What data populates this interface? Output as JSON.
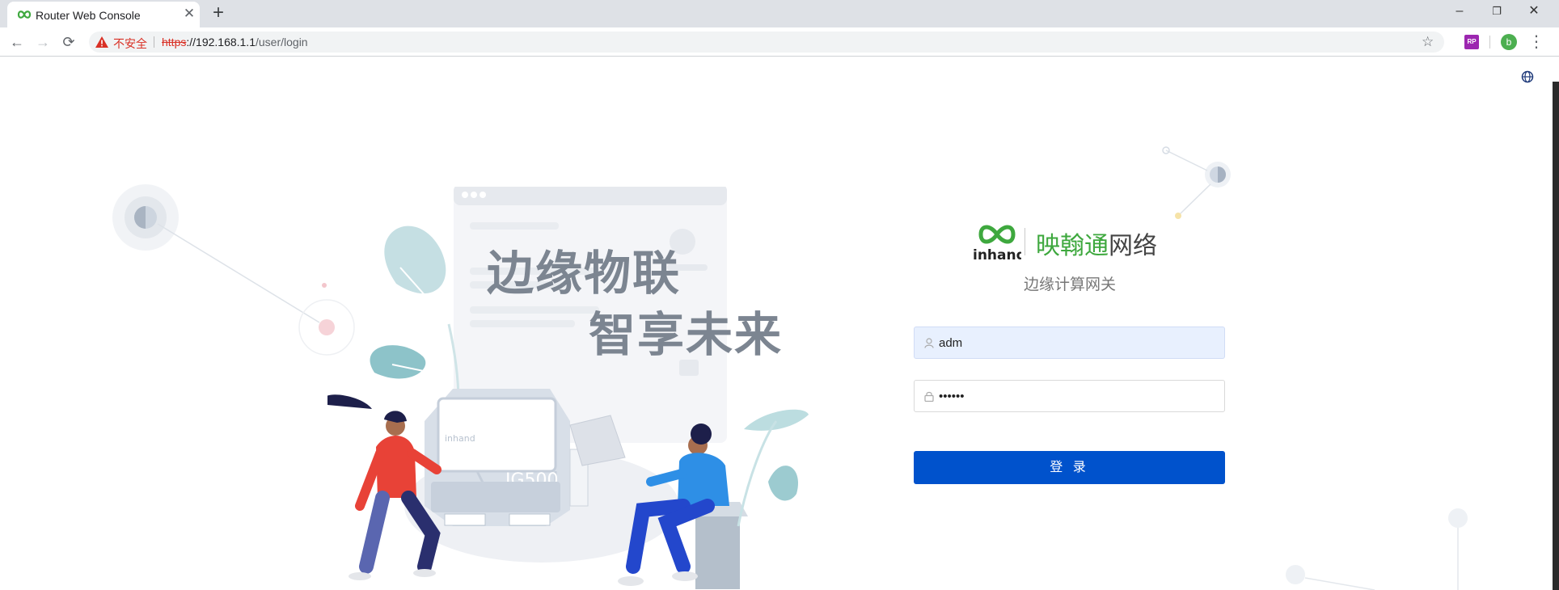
{
  "browser": {
    "tab": {
      "title": "Router Web Console",
      "close_glyph": "✕"
    },
    "new_tab_glyph": "+",
    "window_controls": {
      "minimize": "–",
      "restore": "❐",
      "close": "✕"
    },
    "nav": {
      "back": "←",
      "forward": "→",
      "reload": "⟳"
    },
    "address": {
      "security_label": "不安全",
      "url_scheme": "https",
      "url_host": "://192.168.1.1",
      "url_path": "/user/login"
    },
    "bookmark_glyph": "☆",
    "extension_label": "RP",
    "profile_initial": "b",
    "menu_glyph": "⋮",
    "accent_warning": "#d93025"
  },
  "hero": {
    "slogan_line1": "边缘物联",
    "slogan_line2": "智享未来",
    "device_brand": "inhand",
    "device_model": "IG500"
  },
  "brand": {
    "logo_text": "inhand",
    "name_green": "映翰通",
    "name_dark": "网络",
    "subtitle": "边缘计算网关"
  },
  "login": {
    "username_value": "adm",
    "password_value": "••••••",
    "submit_label": "登 录",
    "button_color": "#0052cc"
  },
  "icons": {
    "language": "globe-icon",
    "username": "user-icon",
    "password": "lock-icon"
  }
}
